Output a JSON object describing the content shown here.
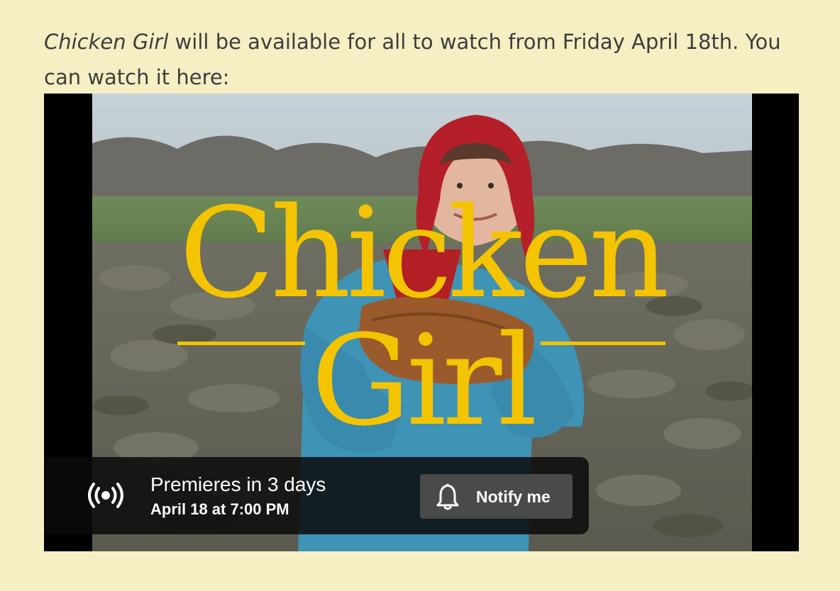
{
  "intro": {
    "title_italic": "Chicken Girl",
    "text": " will be available for all to watch from Friday April 18th. You can watch it here:"
  },
  "video": {
    "title_line1": "Chicken",
    "title_line2": "Girl",
    "premiere_label": "Premieres in 3 days",
    "premiere_date": "April 18 at 7:00 PM",
    "notify_label": "Notify me",
    "icons": [
      "live-broadcast-icon",
      "bell-icon"
    ],
    "colors": {
      "page_background": "#f5efc3",
      "title_yellow": "#f5c400",
      "overlay": "#0a0a0a",
      "button": "#4a4a4a"
    }
  }
}
